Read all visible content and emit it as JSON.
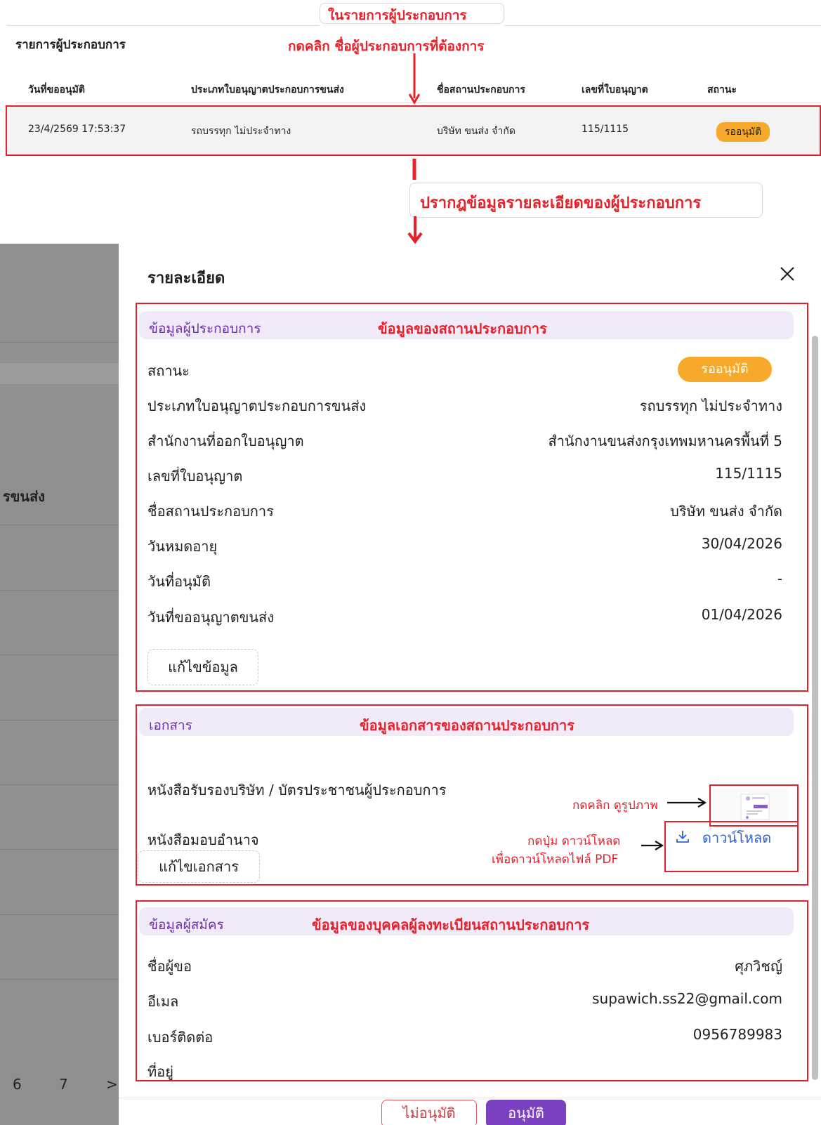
{
  "annotations": {
    "top_callout_line1": "ในรายการผู้ประกอบการ",
    "top_callout_line2": "กดคลิก ชื่อผู้ประกอบการที่ต้องการ",
    "middle_callout": "ปรากฎข้อมูลรายละเอียดของผู้ประกอบการ",
    "operator_section": "ข้อมูลของสถานประกอบการ",
    "documents_section": "ข้อมูลเอกสารของสถานประกอบการ",
    "applicant_section": "ข้อมูลของบุคคลผู้ลงทะเบียนสถานประกอบการ",
    "click_view_image": "กดคลิก ดูรูปภาพ",
    "click_download_line1": "กดปุ่ม ดาวน์โหลด",
    "click_download_line2": "เพื่อดาวน์โหลดไฟล์ PDF"
  },
  "list": {
    "title": "รายการผู้ประกอบการ",
    "columns": [
      "วันที่ขออนุมัติ",
      "ประเภทใบอนุญาตประกอบการขนส่ง",
      "ชื่อสถานประกอบการ",
      "เลขที่ใบอนุญาต",
      "สถานะ"
    ],
    "row": {
      "date": "23/4/2569 17:53:37",
      "license_type": "รถบรรทุก ไม่ประจำทาง",
      "operator_name": "บริษัท ขนส่ง จำกัด",
      "license_no": "115/1115",
      "status": "รออนุมัติ"
    }
  },
  "background_page": {
    "column_fragment": "รขนส่ง",
    "pagination": [
      "6",
      "7",
      ">"
    ]
  },
  "drawer": {
    "title": "รายละเอียด",
    "close_icon": "close-icon",
    "operator_section": {
      "header": "ข้อมูลผู้ประกอบการ",
      "status_label": "สถานะ",
      "status_value": "รออนุมัติ",
      "license_type_label": "ประเภทใบอนุญาตประกอบการขนส่ง",
      "license_type_value": "รถบรรทุก ไม่ประจำทาง",
      "office_label": "สำนักงานที่ออกใบอนุญาต",
      "office_value": "สำนักงานขนส่งกรุงเทพมหานครพื้นที่ 5",
      "license_no_label": "เลขที่ใบอนุญาต",
      "license_no_value": "115/1115",
      "operator_name_label": "ชื่อสถานประกอบการ",
      "operator_name_value": "บริษัท ขนส่ง จำกัด",
      "expiry_label": "วันหมดอายุ",
      "expiry_value": "30/04/2026",
      "approved_date_label": "วันที่อนุมัติ",
      "approved_date_value": "-",
      "request_date_label": "วันที่ขออนุญาตขนส่ง",
      "request_date_value": "01/04/2026",
      "edit_button": "แก้ไขข้อมูล"
    },
    "documents_section": {
      "header": "เอกสาร",
      "doc1_label": "หนังสือรับรองบริษัท / บัตรประชาชนผู้ประกอบการ",
      "doc2_label": "หนังสือมอบอำนาจ",
      "download_icon": "download-icon",
      "download_label": "ดาวน์โหลด",
      "edit_button": "แก้ไขเอกสาร"
    },
    "applicant_section": {
      "header": "ข้อมูลผู้สมัคร",
      "name_label": "ชื่อผู้ขอ",
      "name_value": "ศุภวิชญ์",
      "email_label": "อีเมล",
      "email_value": "supawich.ss22@gmail.com",
      "phone_label": "เบอร์ติดต่อ",
      "phone_value": "0956789983",
      "address_label": "ที่อยู่"
    },
    "footer": {
      "reject_button": "ไม่อนุมัติ",
      "approve_button": "อนุมัติ"
    }
  },
  "colors": {
    "annotation_red": "#e8202a",
    "status_orange": "#f6a92b",
    "section_purple": "#6b2fa6",
    "section_bg": "#f0eaf9",
    "approve_purple": "#7b3fc2",
    "link_blue": "#2f64d6"
  }
}
